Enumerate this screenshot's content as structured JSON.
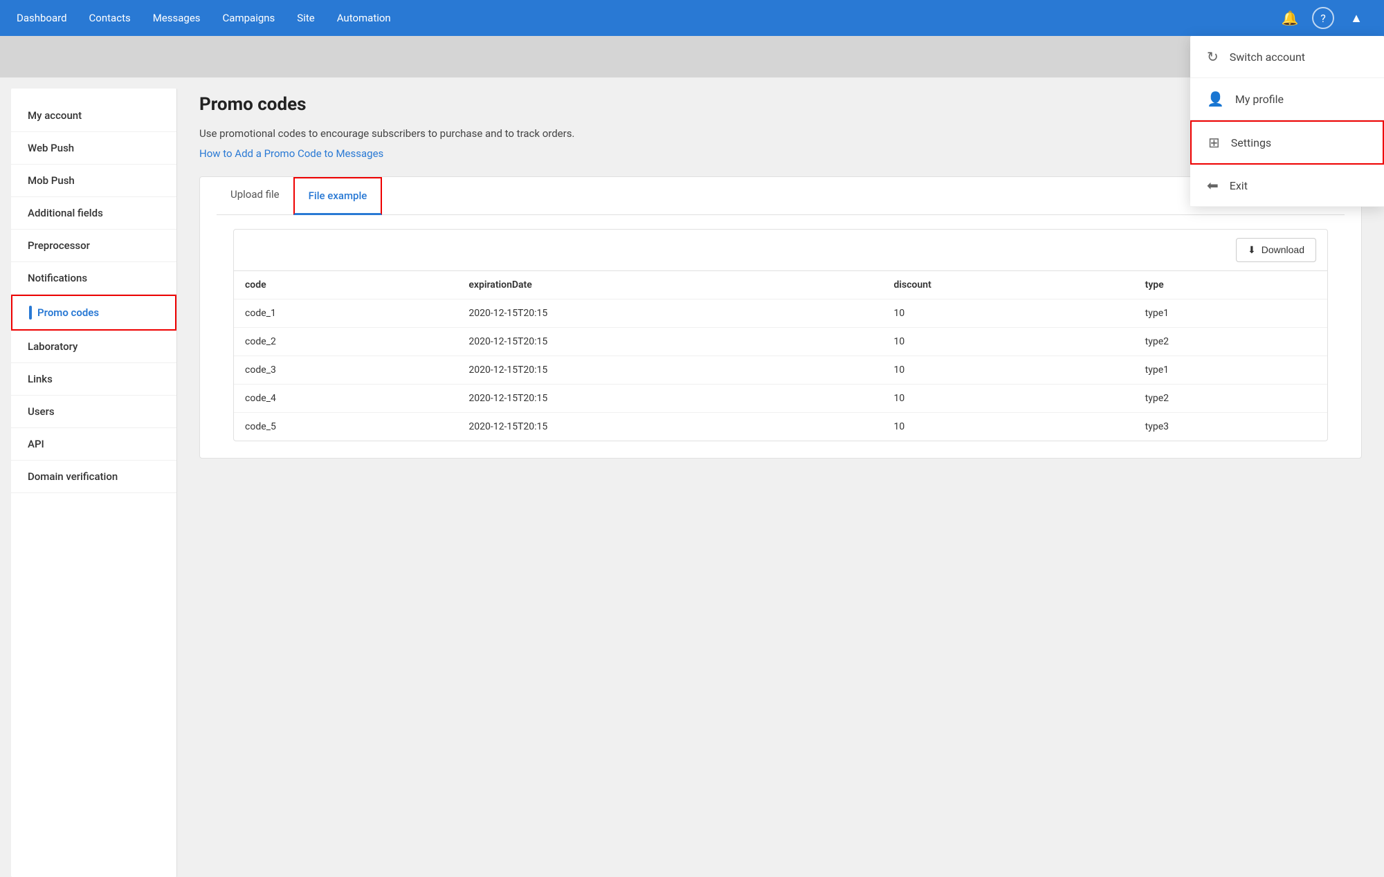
{
  "nav": {
    "links": [
      "Dashboard",
      "Contacts",
      "Messages",
      "Campaigns",
      "Site",
      "Automation"
    ],
    "icons": {
      "bell": "🔔",
      "help": "?",
      "arrow": "▲"
    }
  },
  "dropdown": {
    "items": [
      {
        "id": "switch-account",
        "icon": "↻",
        "label": "Switch account",
        "highlighted": false
      },
      {
        "id": "my-profile",
        "icon": "👤",
        "label": "My profile",
        "highlighted": false
      },
      {
        "id": "settings",
        "icon": "⊞",
        "label": "Settings",
        "highlighted": true
      },
      {
        "id": "exit",
        "icon": "⬅",
        "label": "Exit",
        "highlighted": false
      }
    ]
  },
  "sidebar": {
    "items": [
      {
        "id": "my-account",
        "label": "My account",
        "active": false
      },
      {
        "id": "web-push",
        "label": "Web Push",
        "active": false
      },
      {
        "id": "mob-push",
        "label": "Mob Push",
        "active": false
      },
      {
        "id": "additional-fields",
        "label": "Additional fields",
        "active": false
      },
      {
        "id": "preprocessor",
        "label": "Preprocessor",
        "active": false
      },
      {
        "id": "notifications",
        "label": "Notifications",
        "active": false
      },
      {
        "id": "promo-codes",
        "label": "Promo codes",
        "active": true
      },
      {
        "id": "laboratory",
        "label": "Laboratory",
        "active": false
      },
      {
        "id": "links",
        "label": "Links",
        "active": false
      },
      {
        "id": "users",
        "label": "Users",
        "active": false
      },
      {
        "id": "api",
        "label": "API",
        "active": false
      },
      {
        "id": "domain-verification",
        "label": "Domain verification",
        "active": false
      }
    ]
  },
  "page": {
    "title": "Promo codes",
    "description": "Use promotional codes to encourage subscribers to purchase and to track orders.",
    "link": "How to Add a Promo Code to Messages"
  },
  "tabs": [
    {
      "id": "upload-file",
      "label": "Upload file",
      "active": false
    },
    {
      "id": "file-example",
      "label": "File example",
      "active": true
    }
  ],
  "table": {
    "download_label": "Download",
    "columns": [
      "code",
      "expirationDate",
      "discount",
      "type"
    ],
    "rows": [
      {
        "code": "code_1",
        "expirationDate": "2020-12-15T20:15",
        "discount": "10",
        "type": "type1"
      },
      {
        "code": "code_2",
        "expirationDate": "2020-12-15T20:15",
        "discount": "10",
        "type": "type2"
      },
      {
        "code": "code_3",
        "expirationDate": "2020-12-15T20:15",
        "discount": "10",
        "type": "type1"
      },
      {
        "code": "code_4",
        "expirationDate": "2020-12-15T20:15",
        "discount": "10",
        "type": "type2"
      },
      {
        "code": "code_5",
        "expirationDate": "2020-12-15T20:15",
        "discount": "10",
        "type": "type3"
      }
    ]
  }
}
